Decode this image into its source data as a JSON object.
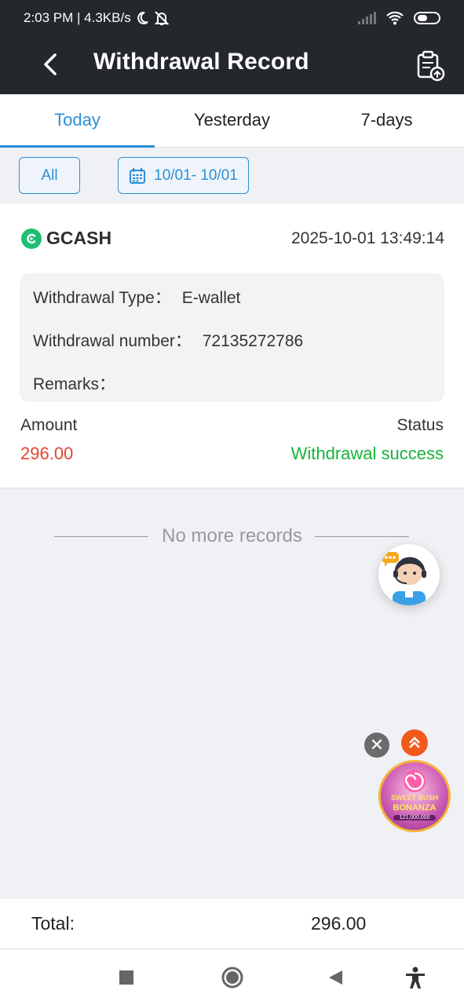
{
  "status_bar": {
    "time_speed": "2:03 PM | 4.3KB/s",
    "icons": [
      "moon-icon",
      "bell-off-icon",
      "signal-icon",
      "wifi-icon",
      "battery-icon"
    ]
  },
  "header": {
    "title": "Withdrawal Record",
    "back_icon": "chevron-left-icon",
    "action_icon": "clipboard-upload-icon"
  },
  "tabs": [
    {
      "label": "Today",
      "active": true
    },
    {
      "label": "Yesterday",
      "active": false
    },
    {
      "label": "7-days",
      "active": false
    }
  ],
  "filters": {
    "type": "All",
    "date_range": "10/01- 10/01"
  },
  "record": {
    "method": "GCASH",
    "datetime": "2025-10-01 13:49:14",
    "type_label": "Withdrawal Type：",
    "type_value": "E-wallet",
    "number_label": "Withdrawal number：",
    "number_value": "72135272786",
    "remarks_label": "Remarks：",
    "remarks_value": "",
    "amount_label": "Amount",
    "amount_value": "296.00",
    "status_label": "Status",
    "status_value": "Withdrawal success"
  },
  "list_end": "No more records",
  "floating": {
    "game_title_1": "SWEET BUSH",
    "game_title_2": "BONANZA",
    "game_amount": "121,000,000"
  },
  "total": {
    "label": "Total:",
    "value": "296.00"
  },
  "colors": {
    "accent": "#2b8fd6",
    "amount": "#e0442e",
    "success": "#19b23a",
    "header_bg": "#24272c"
  }
}
